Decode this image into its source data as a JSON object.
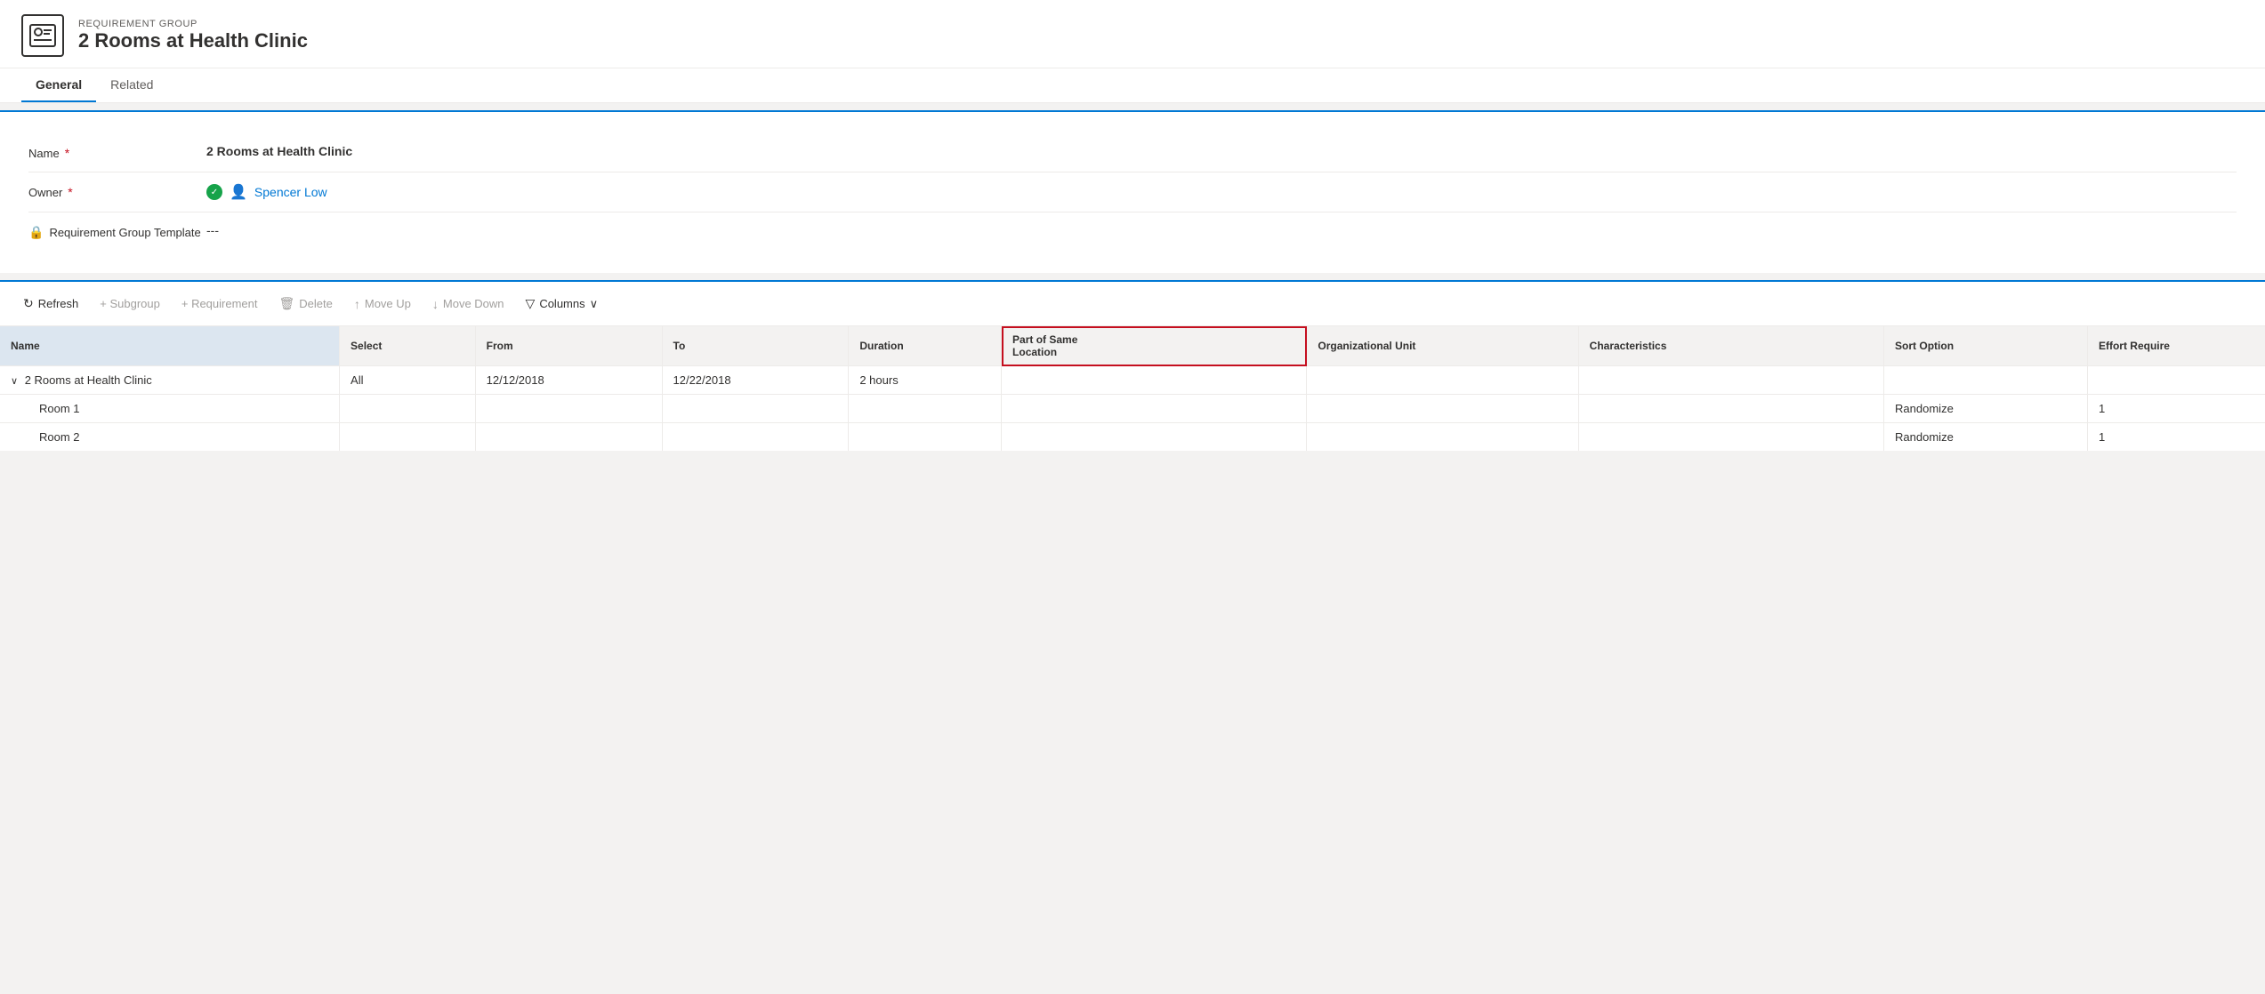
{
  "header": {
    "icon_label": "req-group-icon",
    "req_group_label": "REQUIREMENT GROUP",
    "title": "2 Rooms at Health Clinic"
  },
  "tabs": [
    {
      "id": "general",
      "label": "General",
      "active": true
    },
    {
      "id": "related",
      "label": "Related",
      "active": false
    }
  ],
  "form": {
    "fields": [
      {
        "id": "name",
        "label": "Name",
        "required": true,
        "value": "2 Rooms at Health Clinic",
        "bold": true
      },
      {
        "id": "owner",
        "label": "Owner",
        "required": true,
        "value": "Spencer Low",
        "is_owner": true
      },
      {
        "id": "req_group_template",
        "label": "Requirement Group Template",
        "has_lock": true,
        "value": "---"
      }
    ]
  },
  "toolbar": {
    "refresh_label": "Refresh",
    "subgroup_label": "+ Subgroup",
    "requirement_label": "+ Requirement",
    "delete_label": "Delete",
    "move_up_label": "Move Up",
    "move_down_label": "Move Down",
    "columns_label": "Columns"
  },
  "table": {
    "columns": [
      {
        "id": "name",
        "label": "Name"
      },
      {
        "id": "select",
        "label": "Select"
      },
      {
        "id": "from",
        "label": "From"
      },
      {
        "id": "to",
        "label": "To"
      },
      {
        "id": "duration",
        "label": "Duration"
      },
      {
        "id": "part_of_same_line1",
        "label": "Part of Same",
        "line2": "Location",
        "highlighted": true
      },
      {
        "id": "org_unit",
        "label": "Organizational Unit"
      },
      {
        "id": "characteristics",
        "label": "Characteristics"
      },
      {
        "id": "sort_option",
        "label": "Sort Option"
      },
      {
        "id": "effort_required",
        "label": "Effort Require"
      }
    ],
    "rows": [
      {
        "id": "parent-row",
        "name": "2 Rooms at Health Clinic",
        "expanded": true,
        "select": "All",
        "from": "12/12/2018",
        "to": "12/22/2018",
        "duration": "2 hours",
        "part_of_same": "",
        "org_unit": "",
        "characteristics": "",
        "sort_option": "",
        "effort_required": "",
        "indent": false
      },
      {
        "id": "child-row-1",
        "name": "Room 1",
        "expanded": false,
        "select": "",
        "from": "",
        "to": "",
        "duration": "",
        "part_of_same": "",
        "org_unit": "",
        "characteristics": "",
        "sort_option": "Randomize",
        "effort_required": "1",
        "indent": true
      },
      {
        "id": "child-row-2",
        "name": "Room 2",
        "expanded": false,
        "select": "",
        "from": "",
        "to": "",
        "duration": "",
        "part_of_same": "",
        "org_unit": "",
        "characteristics": "",
        "sort_option": "Randomize",
        "effort_required": "1",
        "indent": true
      }
    ]
  }
}
